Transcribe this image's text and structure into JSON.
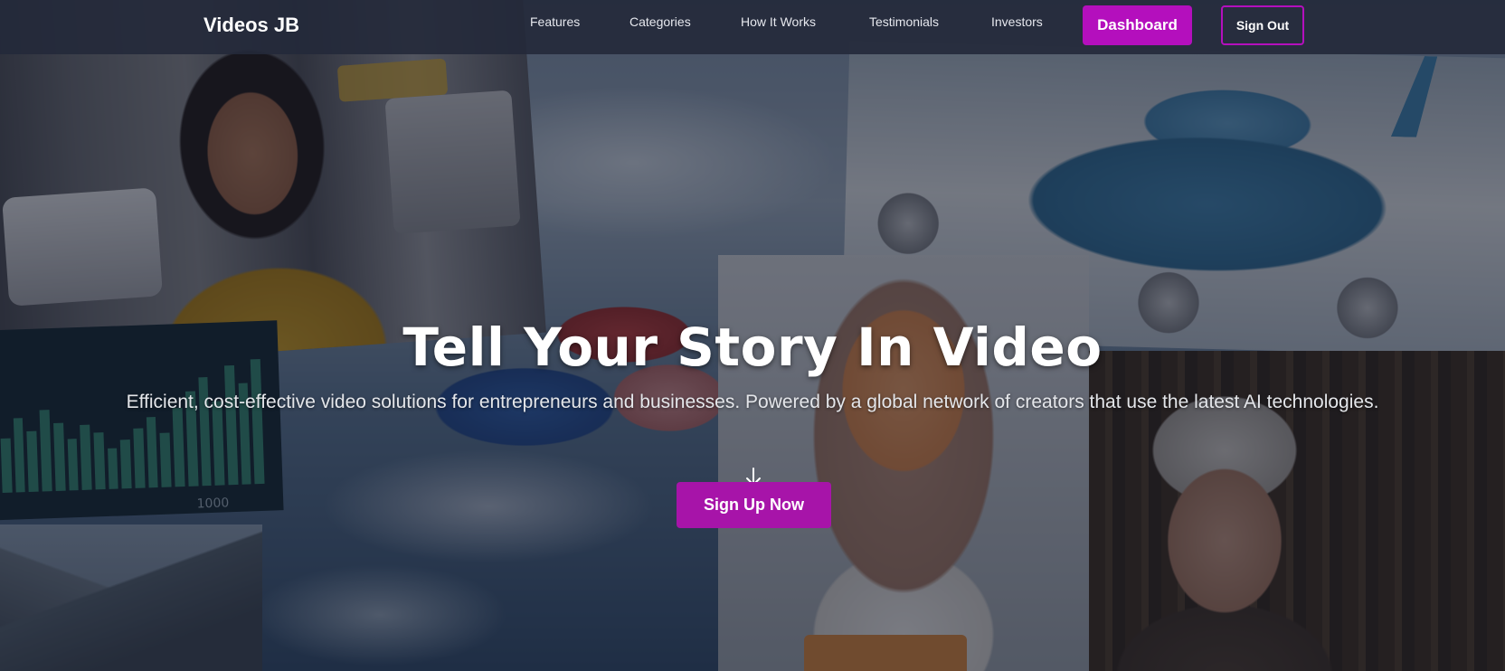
{
  "header": {
    "brand": "Videos JB",
    "nav": {
      "features": "Features",
      "categories": "Categories",
      "how_it_works": "How It Works",
      "testimonials": "Testimonials",
      "investors": "Investors"
    },
    "dashboard_label": "Dashboard",
    "signout_label": "Sign Out"
  },
  "hero": {
    "title": "Tell Your Story In Video",
    "subtitle": "Efficient, cost-effective video solutions for entrepreneurs and businesses. Powered by a global network of creators that use the latest AI technologies.",
    "cta_label": "Sign Up Now",
    "cta_icon": "arrow-down-icon"
  },
  "background_tiles": {
    "chart_tick_label": "1000"
  },
  "colors": {
    "accent": "#b40fbd",
    "cta": "#a714a9",
    "nav_bg": "#24293a"
  }
}
